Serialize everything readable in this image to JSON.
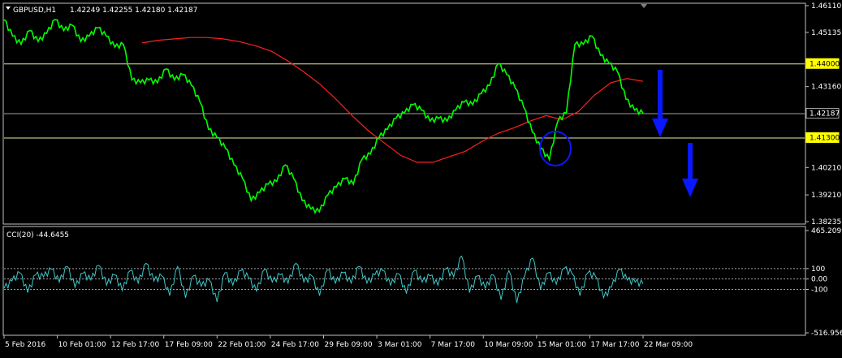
{
  "header": {
    "symbol_label": "GBPUSD,H1",
    "ohlc_text": "1.42249 1.42255 1.42180 1.42187"
  },
  "indicator": {
    "label": "CCI(20) -44.6455"
  },
  "colors": {
    "background": "#000000",
    "frame": "#c0c0c0",
    "price_line": "#00ff00",
    "moving_average": "#ff2020",
    "horizontal_level": "#e8e8a0",
    "current_price_line": "#a0a0a0",
    "level_tag": "#ffff00",
    "annotation_blue": "#0a18ff",
    "cci_line": "#40c8c8",
    "cci_levels": "#a0a0a0"
  },
  "chart_data": [
    {
      "type": "line",
      "title": "GBPUSD,H1",
      "x": [
        "5 Feb 2016",
        "10 Feb 01:00",
        "12 Feb 17:00",
        "17 Feb 09:00",
        "22 Feb 01:00",
        "24 Feb 17:00",
        "29 Feb 09:00",
        "3 Mar 01:00",
        "7 Mar 17:00",
        "10 Mar 09:00",
        "15 Mar 01:00",
        "17 Mar 17:00",
        "22 Mar 09:00"
      ],
      "ylim": [
        1.38235,
        1.4611
      ],
      "y_ticks": [
        1.4611,
        1.45135,
        1.4316,
        1.4021,
        1.3921,
        1.38235
      ],
      "y_tick_labels": [
        "1.46110",
        "1.45135",
        "1.43160",
        "1.40210",
        "1.39210",
        "1.38235"
      ],
      "series": [
        {
          "values": [
            1.456,
            1.45,
            1.447,
            1.452,
            1.448,
            1.451,
            1.456,
            1.452,
            1.454,
            1.448,
            1.45,
            1.453,
            1.45,
            1.446,
            1.447,
            1.434,
            1.433,
            1.434,
            1.433,
            1.438,
            1.434,
            1.436,
            1.432,
            1.426,
            1.416,
            1.413,
            1.409,
            1.403,
            1.398,
            1.39,
            1.393,
            1.396,
            1.397,
            1.403,
            1.398,
            1.39,
            1.387,
            1.386,
            1.392,
            1.395,
            1.398,
            1.396,
            1.405,
            1.407,
            1.413,
            1.416,
            1.42,
            1.422,
            1.425,
            1.423,
            1.419,
            1.42,
            1.419,
            1.423,
            1.426,
            1.425,
            1.429,
            1.432,
            1.44,
            1.436,
            1.431,
            1.424,
            1.415,
            1.409,
            1.405,
            1.419,
            1.422,
            1.447,
            1.447,
            1.45,
            1.443,
            1.44,
            1.437,
            1.427,
            1.423,
            1.4219
          ]
        },
        {
          "values": [
            1.4475,
            1.4485,
            1.449,
            1.4495,
            1.4495,
            1.449,
            1.448,
            1.4465,
            1.4445,
            1.441,
            1.437,
            1.4325,
            1.427,
            1.421,
            1.4155,
            1.411,
            1.4065,
            1.404,
            1.404,
            1.406,
            1.408,
            1.4115,
            1.4145,
            1.4165,
            1.419,
            1.421,
            1.4195,
            1.4225,
            1.4285,
            1.433,
            1.4345,
            1.4335
          ]
        }
      ],
      "levels": [
        {
          "value": 1.44,
          "label": "1.44000"
        },
        {
          "value": 1.42187,
          "label": "1.42187"
        },
        {
          "value": 1.413,
          "label": "1.41300"
        }
      ]
    },
    {
      "type": "line",
      "title": "CCI(20) -44.6455",
      "ylim": [
        -516.956,
        465.2099
      ],
      "y_tick_labels": [
        "465.2099",
        "100",
        "0.00",
        "-100",
        "-516.956"
      ],
      "levels": [
        100,
        0,
        -100
      ],
      "series": [
        {
          "values": [
            -90,
            -20,
            60,
            -130,
            40,
            20,
            95,
            -30,
            120,
            -80,
            55,
            -10,
            130,
            -60,
            40,
            -110,
            80,
            -40,
            150,
            -20,
            30,
            -160,
            120,
            -180,
            30,
            -70,
            -10,
            -220,
            60,
            -60,
            80,
            10,
            -120,
            90,
            -30,
            40,
            -40,
            150,
            -30,
            30,
            -160,
            90,
            -40,
            60,
            -40,
            120,
            -40,
            40,
            80,
            -60,
            50,
            -140,
            80,
            -30,
            30,
            -60,
            100,
            20,
            220,
            -130,
            30,
            -90,
            40,
            -200,
            80,
            -230,
            30,
            200,
            -100,
            60,
            -50,
            100,
            50,
            -160,
            60,
            20,
            -180,
            -80,
            90,
            -10,
            -30,
            -45
          ]
        }
      ]
    }
  ]
}
